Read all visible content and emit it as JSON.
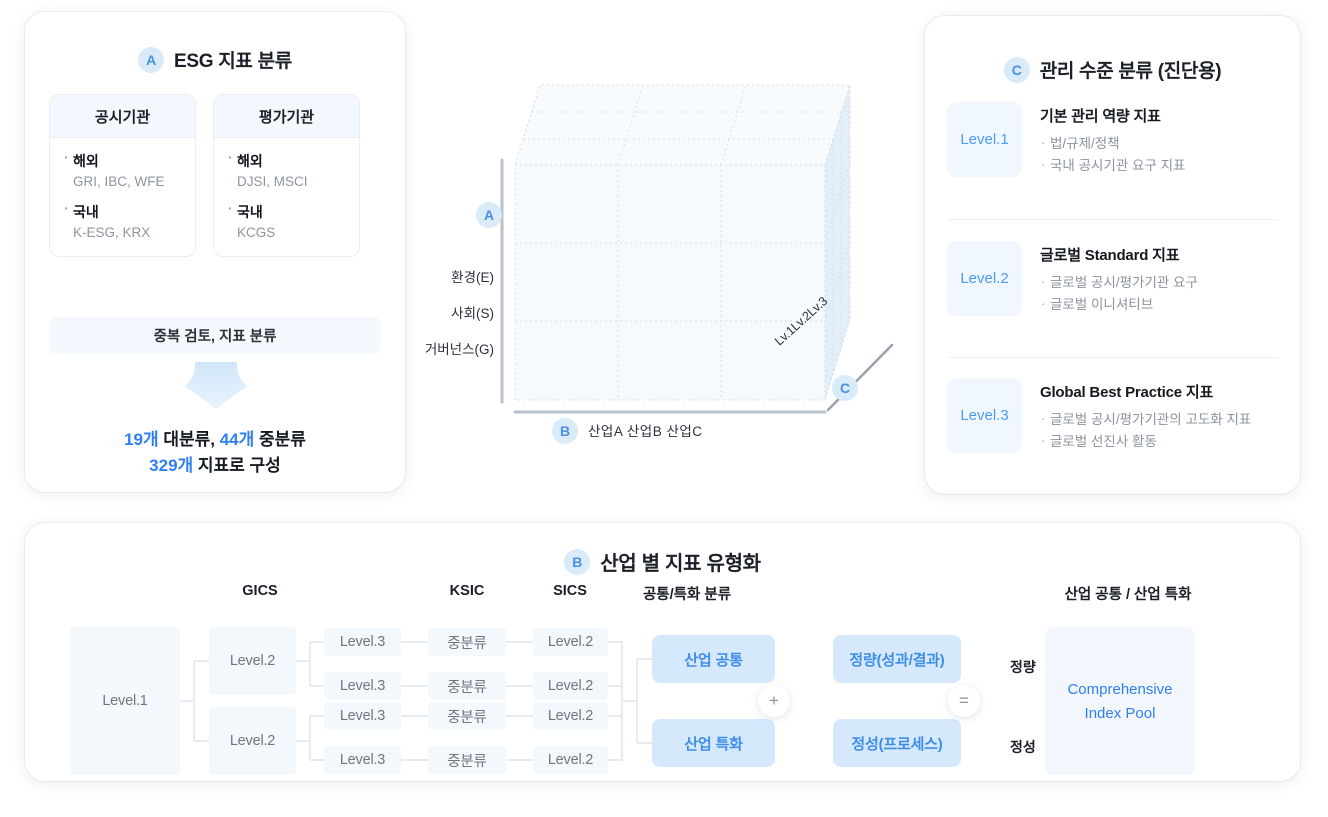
{
  "panel_a": {
    "badge": "A",
    "title": "ESG 지표 분류",
    "institutions": [
      {
        "header": "공시기관",
        "groups": [
          {
            "label": "해외",
            "value": "GRI, IBC, WFE"
          },
          {
            "label": "국내",
            "value": "K-ESG, KRX"
          }
        ]
      },
      {
        "header": "평가기관",
        "groups": [
          {
            "label": "해외",
            "value": "DJSI, MSCI"
          },
          {
            "label": "국내",
            "value": "KCGS"
          }
        ]
      }
    ],
    "review_bar": "중복 검토, 지표 분류",
    "summary": {
      "line1_n1": "19개",
      "line1_t1": " 대분류, ",
      "line1_n2": "44개",
      "line1_t2": " 중분류",
      "line2_n1": "329개",
      "line2_t1": " 지표로 구성"
    }
  },
  "cube": {
    "badge_a": "A",
    "badge_b": "B",
    "badge_c": "C",
    "y_axis": [
      "환경(E)",
      "사회(S)",
      "거버넌스(G)"
    ],
    "x_axis": "산업A  산업B  산업C",
    "z_axis": "Lv.1Lv.2Lv.3",
    "grid": 3
  },
  "panel_c": {
    "badge": "C",
    "title": "관리 수준 분류 (진단용)",
    "levels": [
      {
        "badge": "Level.1",
        "title": "기본 관리 역량 지표",
        "items": [
          "법/규제/정책",
          "국내 공시기관 요구 지표"
        ]
      },
      {
        "badge": "Level.2",
        "title": "글로벌 Standard 지표",
        "items": [
          "글로벌 공시/평가기관 요구",
          "글로벌 이니셔티브"
        ]
      },
      {
        "badge": "Level.3",
        "title": "Global Best Practice 지표",
        "items": [
          "글로벌 공시/평가기관의 고도화 지표",
          "글로벌 선진사 활동"
        ]
      }
    ]
  },
  "panel_b": {
    "badge": "B",
    "title": "산업 별 지표 유형화",
    "headers": {
      "gics": "GICS",
      "ksic": "KSIC",
      "sics": "SICS",
      "common": "공통/특화 분류",
      "result": "산업 공통 / 산업 특화"
    },
    "level1": "Level.1",
    "gics_level2": [
      "Level.2",
      "Level.2"
    ],
    "gics_level3": [
      "Level.3",
      "Level.3",
      "Level.3",
      "Level.3"
    ],
    "ksic": [
      "중분류",
      "중분류",
      "중분류",
      "중분류"
    ],
    "sics": [
      "Level.2",
      "Level.2",
      "Level.2",
      "Level.2"
    ],
    "common": [
      "산업 공통",
      "산업 특화"
    ],
    "plus": "+",
    "quant": [
      "정량(성과/결과)",
      "정성(프로세스)"
    ],
    "equals": "=",
    "side_labels": [
      "정량",
      "정성"
    ],
    "pool_line1": "Comprehensive",
    "pool_line2": "Index Pool"
  },
  "colors": {
    "accent_blue": "#2f7ff0",
    "badge_bg": "#d9eaf9",
    "chip_bg": "#f3f8fd",
    "chip_blue_bg": "#d6e9fc",
    "muted_text": "#8d959f"
  }
}
